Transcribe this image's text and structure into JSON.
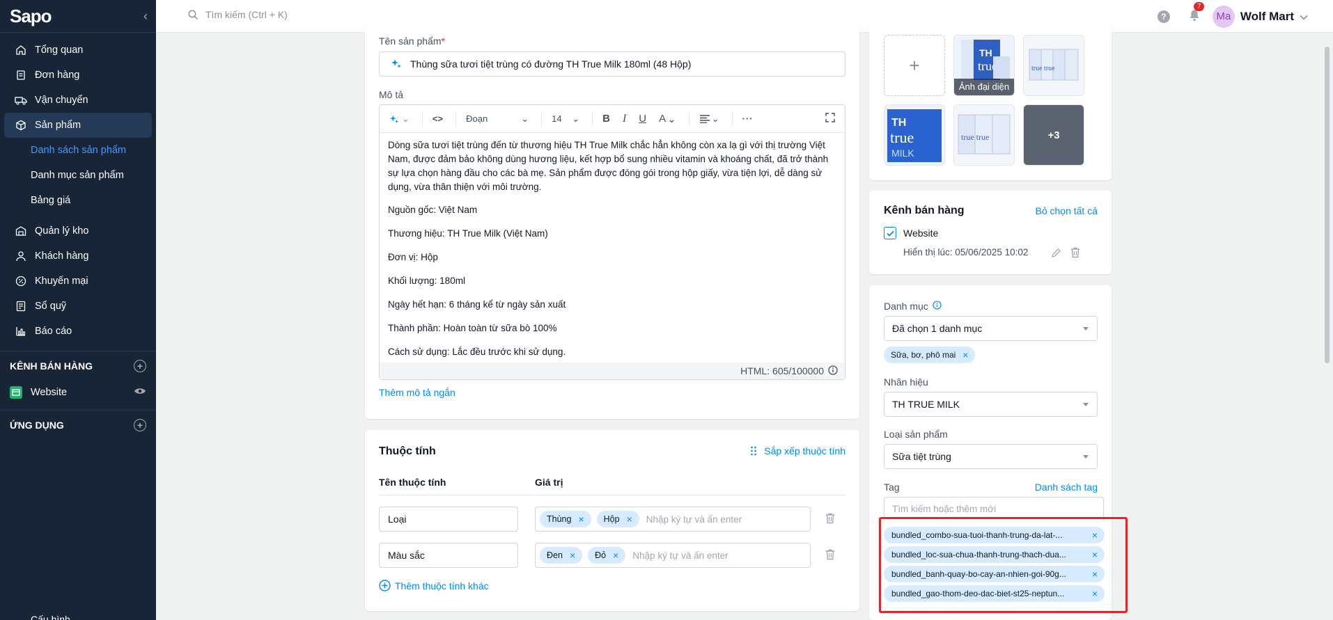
{
  "sidebar": {
    "logo": "Sapo",
    "items": [
      {
        "label": "Tổng quan",
        "icon": "home-icon"
      },
      {
        "label": "Đơn hàng",
        "icon": "order-icon"
      },
      {
        "label": "Vận chuyển",
        "icon": "truck-icon"
      },
      {
        "label": "Sản phẩm",
        "icon": "box-icon"
      }
    ],
    "product_subitems": [
      "Danh sách sản phẩm",
      "Danh mục sản phẩm",
      "Bảng giá"
    ],
    "items2": [
      {
        "label": "Quản lý kho",
        "icon": "warehouse-icon"
      },
      {
        "label": "Khách hàng",
        "icon": "user-icon"
      },
      {
        "label": "Khuyến mại",
        "icon": "discount-icon"
      },
      {
        "label": "Sổ quỹ",
        "icon": "cashbook-icon"
      },
      {
        "label": "Báo cáo",
        "icon": "chart-icon"
      }
    ],
    "sales_channels_header": "KÊNH BÁN HÀNG",
    "website_label": "Website",
    "apps_header": "ỨNG DỤNG",
    "bottom_label": "Cấu hình"
  },
  "topbar": {
    "search_placeholder": "Tìm kiếm (Ctrl + K)",
    "notification_count": "7",
    "avatar_initials": "Ma",
    "store_name": "Wolf Mart"
  },
  "product": {
    "name_label": "Tên sản phẩm",
    "name_required": "*",
    "name_value": "Thùng sữa tươi tiệt trùng có đường TH True Milk 180ml (48 Hộp)",
    "desc_label": "Mô tả",
    "toolbar": {
      "format": "Đoạn",
      "size": "14"
    },
    "description": [
      "Dòng sữa tươi tiệt trùng đến từ thương hiệu TH True Milk chắc hẳn không còn xa lạ gì với thị trường Việt Nam, được đảm bảo không dùng hương liệu, kết hợp bổ sung nhiều vitamin và khoáng chất, đã trở thành sự lựa chọn hàng đầu cho các bà mẹ. Sản phẩm được đóng gói trong hộp giấy, vừa tiện lợi, dễ dàng sử dụng, vừa thân thiện với môi trường.",
      "Nguồn gốc: Việt Nam",
      "Thương hiệu: TH True Milk (Việt Nam)",
      "Đơn vị: Hộp",
      "Khối lượng: 180ml",
      "Ngày hết hạn: 6 tháng kể từ ngày sản xuất",
      "Thành phần: Hoàn toàn từ sữa bò 100%",
      "Cách sử dụng: Lắc đều trước khi sử dụng."
    ],
    "html_count": "HTML: 605/100000",
    "add_short_desc": "Thêm mô tả ngắn"
  },
  "attributes": {
    "title": "Thuộc tính",
    "sort_link": "Sắp xếp thuộc tính",
    "col_name": "Tên thuộc tính",
    "col_value": "Giá trị",
    "rows": [
      {
        "name": "Loại",
        "values": [
          "Thùng",
          "Hộp"
        ],
        "placeholder": "Nhập ký tự và ấn enter"
      },
      {
        "name": "Màu sắc",
        "values": [
          "Đen",
          "Đỏ"
        ],
        "placeholder": "Nhập ký tự và ấn enter"
      }
    ],
    "add_link": "Thêm thuộc tính khác"
  },
  "images": {
    "cover_label": "Ảnh đại diện",
    "more_count": "+3"
  },
  "channels": {
    "title": "Kênh bán hàng",
    "deselect_all": "Bỏ chọn tất cả",
    "website": "Website",
    "display_time": "Hiển thị lúc: 05/06/2025 10:02"
  },
  "organization": {
    "category_label": "Danh mục",
    "category_value": "Đã chọn 1 danh mục",
    "category_chip": "Sữa, bơ, phô mai",
    "brand_label": "Nhãn hiệu",
    "brand_value": "TH TRUE MILK",
    "type_label": "Loại sản phẩm",
    "type_value": "Sữa tiệt trùng",
    "tag_label": "Tag",
    "tag_list_link": "Danh sách tag",
    "tag_placeholder": "Tìm kiếm hoặc thêm mới",
    "tags": [
      "bundled_combo-sua-tuoi-thanh-trung-da-lat-...",
      "bundled_loc-sua-chua-thanh-trung-thach-dua...",
      "bundled_banh-quay-bo-cay-an-nhien-goi-90g...",
      "bundled_gao-thom-deo-dac-biet-st25-neptun..."
    ]
  },
  "colors": {
    "accent": "#0088ff",
    "sidebar_bg": "#182537",
    "highlight": "#e0272a",
    "chip_bg": "#d6ebff"
  }
}
